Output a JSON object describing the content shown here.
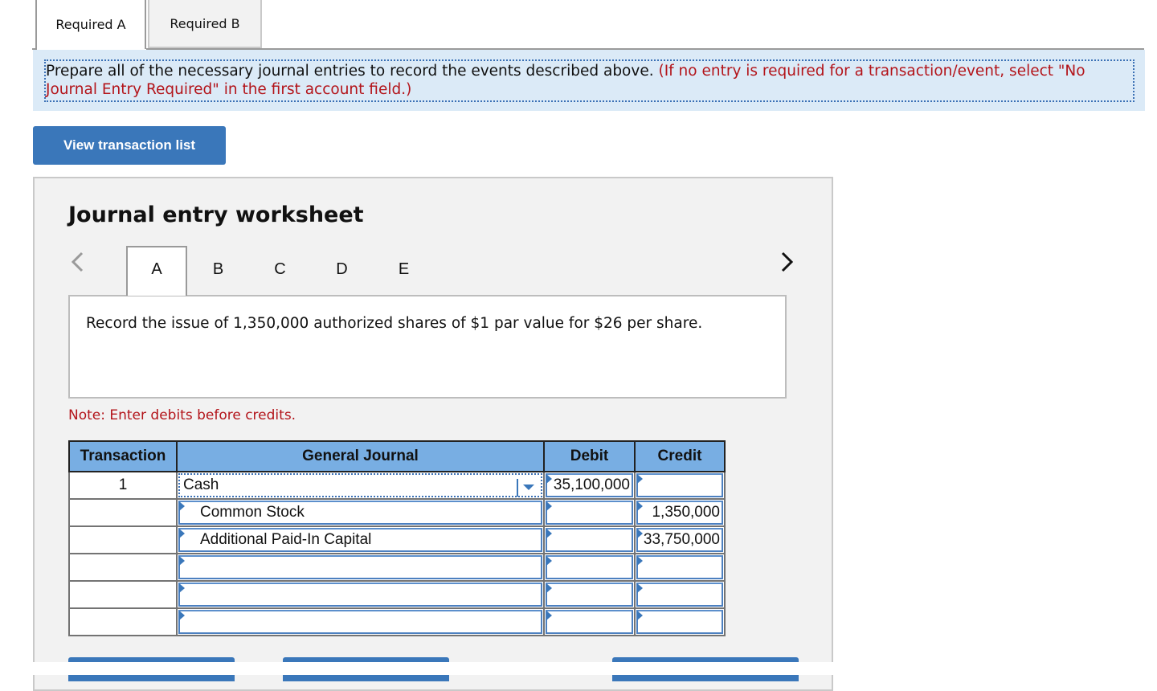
{
  "tabs": [
    {
      "label": "Required A",
      "active": true
    },
    {
      "label": "Required B",
      "active": false
    }
  ],
  "instruction": {
    "main": "Prepare all of the necessary journal entries to record the events described above.",
    "note": "(If no entry is required for a transaction/event, select \"No Journal Entry Required\" in the first account field.)"
  },
  "view_transaction_list_label": "View transaction list",
  "worksheet": {
    "title": "Journal entry worksheet",
    "nav_prev": "<",
    "nav_next": ">",
    "letter_tabs": [
      {
        "label": "A",
        "active": true
      },
      {
        "label": "B",
        "active": false
      },
      {
        "label": "C",
        "active": false
      },
      {
        "label": "D",
        "active": false
      },
      {
        "label": "E",
        "active": false
      }
    ],
    "description": "Record the issue of 1,350,000 authorized shares of $1 par value for $26 per share.",
    "note": "Note: Enter debits before credits.",
    "table": {
      "headers": {
        "transaction": "Transaction",
        "general_journal": "General Journal",
        "debit": "Debit",
        "credit": "Credit"
      },
      "rows": [
        {
          "transaction": "1",
          "account": "Cash",
          "debit": "35,100,000",
          "credit": ""
        },
        {
          "transaction": "",
          "account": "Common Stock",
          "debit": "",
          "credit": "1,350,000"
        },
        {
          "transaction": "",
          "account": "Additional Paid-In Capital",
          "debit": "",
          "credit": "33,750,000"
        },
        {
          "transaction": "",
          "account": "",
          "debit": "",
          "credit": ""
        },
        {
          "transaction": "",
          "account": "",
          "debit": "",
          "credit": ""
        },
        {
          "transaction": "",
          "account": "",
          "debit": "",
          "credit": ""
        }
      ]
    }
  },
  "colors": {
    "accent_blue": "#3a77ba",
    "header_blue": "#78aee3",
    "instruction_bg": "#dbeaf7",
    "note_red": "#b3141a",
    "panel_bg": "#f2f2f2"
  }
}
